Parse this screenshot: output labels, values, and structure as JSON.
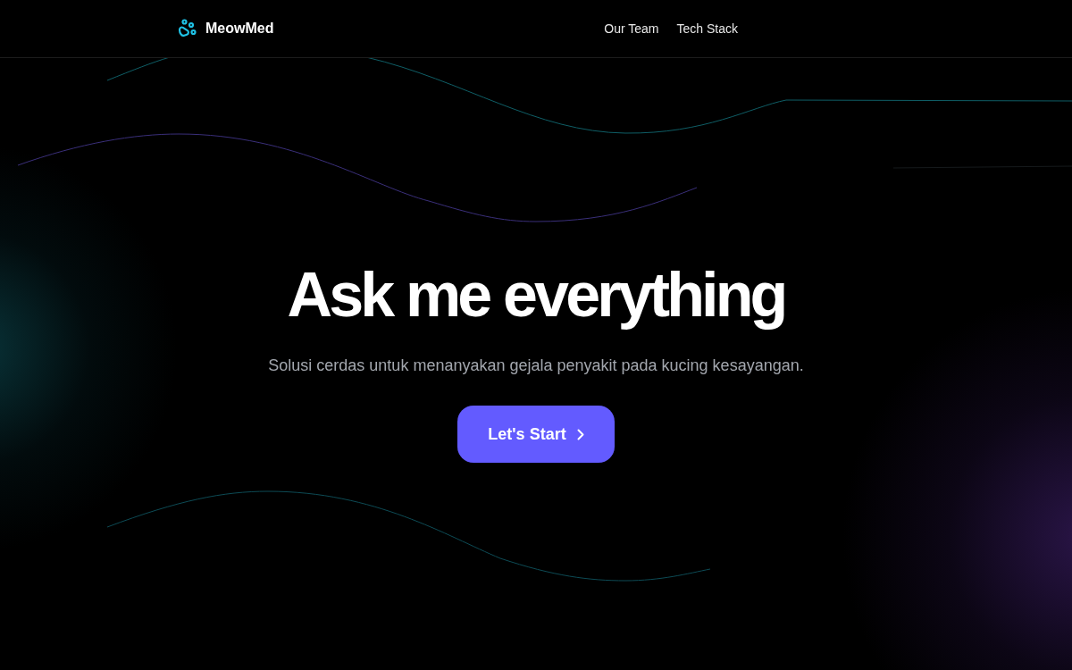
{
  "header": {
    "brand": "MeowMed",
    "nav": [
      {
        "label": "Our Team"
      },
      {
        "label": "Tech Stack"
      }
    ]
  },
  "hero": {
    "title": "Ask me everything",
    "subtitle": "Solusi cerdas untuk menanyakan gejala penyakit pada kucing kesayangan.",
    "button": "Let's Start"
  }
}
